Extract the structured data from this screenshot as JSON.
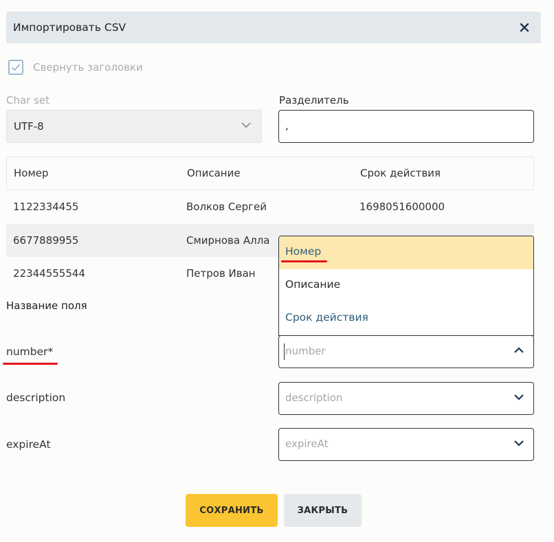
{
  "dialog": {
    "title": "Импортировать CSV",
    "close_icon": "close-icon"
  },
  "options": {
    "collapse_headers_label": "Свернуть заголовки",
    "collapse_headers_checked": true
  },
  "charset": {
    "label": "Char set",
    "value": "UTF-8",
    "disabled": true
  },
  "separator": {
    "label": "Разделитель",
    "value": ","
  },
  "table": {
    "headers": [
      "Номер",
      "Описание",
      "Срок действия"
    ],
    "rows": [
      [
        "1122334455",
        "Волков Сергей",
        "1698051600000"
      ],
      [
        "6677889955",
        "Смирнова Алла",
        ""
      ],
      [
        "22344555544",
        "Петров Иван",
        ""
      ]
    ]
  },
  "mapping": {
    "title": "Название поля",
    "fields": [
      {
        "name": "number*",
        "placeholder": "number",
        "open": true
      },
      {
        "name": "description",
        "placeholder": "description",
        "open": false
      },
      {
        "name": "expireAt",
        "placeholder": "expireAt",
        "open": false
      }
    ],
    "dropdown_options": [
      "Номер",
      "Описание",
      "Срок действия"
    ],
    "highlighted_option": "Номер"
  },
  "actions": {
    "save_label": "СОХРАНИТЬ",
    "close_label": "ЗАКРЫТЬ"
  },
  "colors": {
    "header_bg": "#e3e8ec",
    "accent": "#fbc531",
    "highlight": "#fde8b0",
    "annotation_red": "#e8141c",
    "option_text": "#2f5d7c"
  }
}
